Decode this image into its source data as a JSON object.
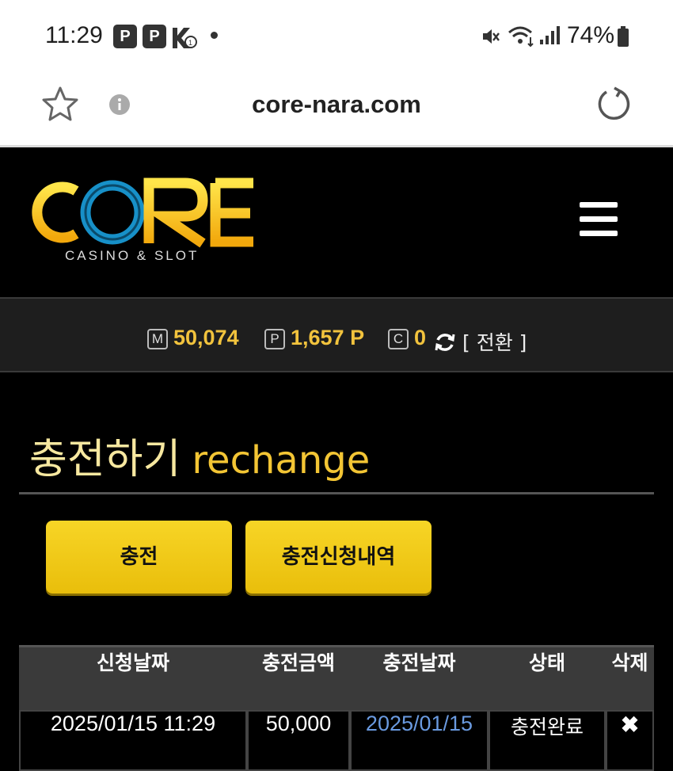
{
  "status_bar": {
    "time": "11:29",
    "badges": [
      "P",
      "P"
    ],
    "battery": "74%"
  },
  "browser": {
    "url": "core-nara.com"
  },
  "header": {
    "logo_text": "CORE",
    "logo_sub": "CASINO & SLOT"
  },
  "balance": {
    "money_icon": "M",
    "money": "50,074",
    "point_icon": "P",
    "points": "1,657 P",
    "coin_icon": "C",
    "coin": "0",
    "convert_label": "[ 전환 ]"
  },
  "page": {
    "title_ko": "충전하기",
    "title_en": "rechange"
  },
  "tabs": {
    "charge": "충전",
    "history": "충전신청내역"
  },
  "table": {
    "headers": [
      "신청날짜",
      "충전금액",
      "충전날짜",
      "상태",
      "삭제"
    ],
    "rows": [
      [
        "2025/01/15 11:29",
        "50,000",
        "2025/01/15",
        "충전완료",
        "✖"
      ]
    ]
  },
  "colors": {
    "accent_gold": "#f2c33d",
    "button_yellow": "#f5cf1c",
    "link_blue": "#6a9ae0",
    "logo_blue": "#1790c8"
  }
}
